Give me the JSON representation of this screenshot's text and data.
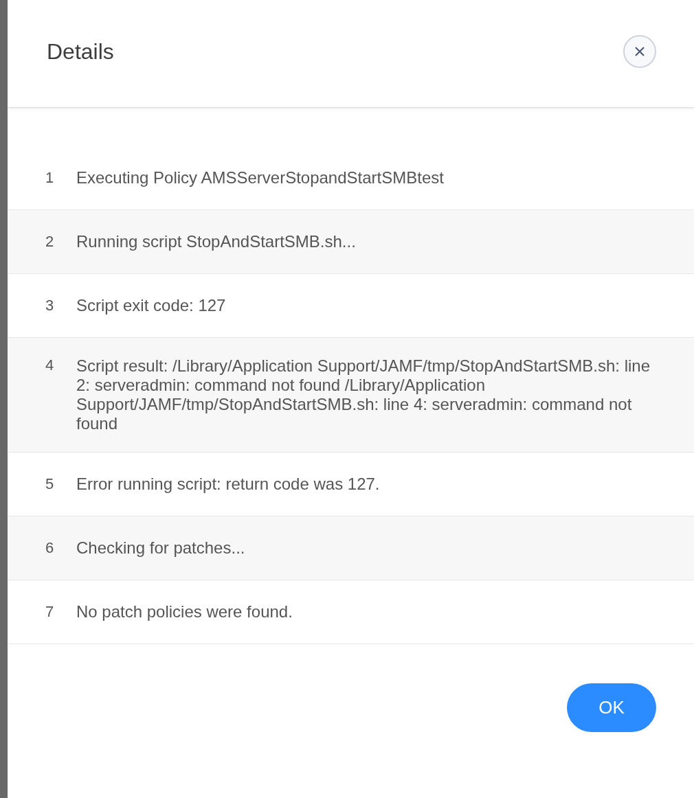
{
  "dialog": {
    "title": "Details",
    "log": [
      {
        "number": "1",
        "text": "Executing Policy AMSServerStopandStartSMBtest"
      },
      {
        "number": "2",
        "text": "Running script StopAndStartSMB.sh..."
      },
      {
        "number": "3",
        "text": "Script exit code: 127"
      },
      {
        "number": "4",
        "text": "Script result: /Library/Application Support/JAMF/tmp/StopAndStartSMB.sh: line 2: serveradmin: command not found /Library/Application Support/JAMF/tmp/StopAndStartSMB.sh: line 4: serveradmin: command not found"
      },
      {
        "number": "5",
        "text": "Error running script: return code was 127."
      },
      {
        "number": "6",
        "text": "Checking for patches..."
      },
      {
        "number": "7",
        "text": "No patch policies were found."
      }
    ],
    "buttons": [
      "OK"
    ]
  }
}
